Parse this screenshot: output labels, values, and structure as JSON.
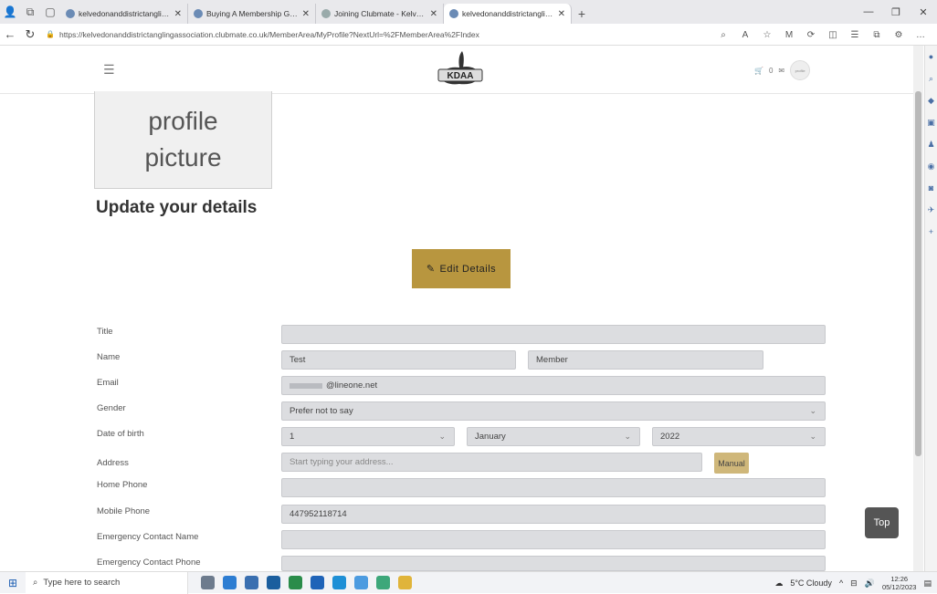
{
  "browser": {
    "tabs": [
      {
        "title": "kelvedonanddistrictanglingassoc",
        "active": false
      },
      {
        "title": "Buying A Membership Guide | Cl",
        "active": false
      },
      {
        "title": "Joining Clubmate - Kelvedon Dis",
        "active": false
      },
      {
        "title": "kelvedonanddistrictanglingassoc",
        "active": true
      }
    ],
    "url": "https://kelvedonanddistrictanglingassociation.clubmate.co.uk/MemberArea/MyProfile?NextUrl=%2FMemberArea%2FIndex"
  },
  "header": {
    "logo_text": "KDAA",
    "basket_count": "0"
  },
  "profile_picture": {
    "line1": "profile",
    "line2": "picture"
  },
  "section_title": "Update your details",
  "edit_button_label": "Edit Details",
  "form": {
    "title_label": "Title",
    "title_value": "",
    "name_label": "Name",
    "first_name": "Test",
    "last_name": "Member",
    "email_label": "Email",
    "email_value": "@lineone.net",
    "gender_label": "Gender",
    "gender_value": "Prefer not to say",
    "dob_label": "Date of birth",
    "dob_day": "1",
    "dob_month": "January",
    "dob_year": "2022",
    "address_label": "Address",
    "address_placeholder": "Start typing your address...",
    "manual_label": "Manual",
    "home_phone_label": "Home Phone",
    "home_phone_value": "",
    "mobile_phone_label": "Mobile Phone",
    "mobile_phone_value": "447952118714",
    "emergency_name_label": "Emergency Contact Name",
    "emergency_name_value": "",
    "emergency_phone_label": "Emergency Contact Phone",
    "emergency_phone_value": ""
  },
  "top_button_label": "Top",
  "taskbar": {
    "search_placeholder": "Type here to search",
    "weather": "5°C Cloudy",
    "time": "12:26",
    "date": "05/12/2023"
  },
  "colors": {
    "accent_gold": "#b8963f",
    "field_bg": "#dcdde0",
    "top_button": "#555555"
  }
}
